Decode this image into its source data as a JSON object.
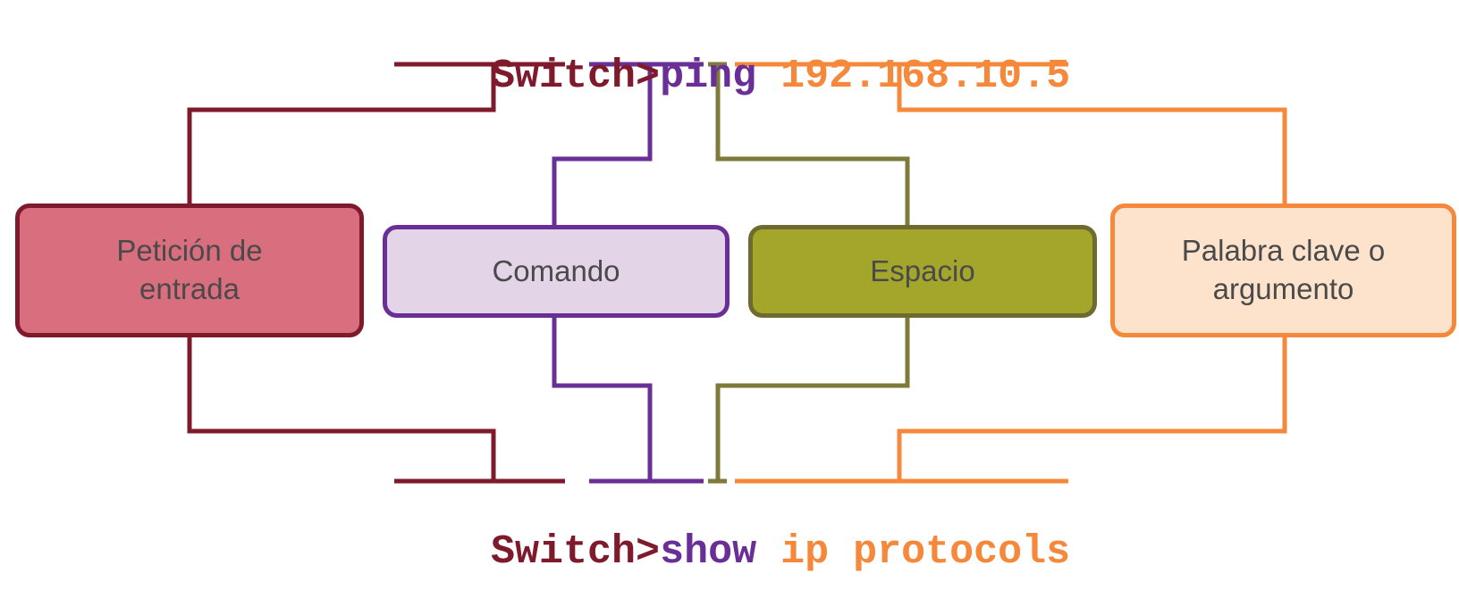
{
  "colors": {
    "prompt": "#7f1a2d",
    "command": "#6a2f97",
    "space": "#7d7a3a",
    "argument": "#f5883a"
  },
  "top_line": {
    "prompt": "Switch>",
    "command": "ping",
    "argument": "192.168.10.5"
  },
  "bottom_line": {
    "prompt": "Switch>",
    "command": "show",
    "argument": "ip protocols"
  },
  "boxes": {
    "prompt": {
      "line1": "Petición de",
      "line2": "entrada"
    },
    "command": {
      "line1": "Comando"
    },
    "space": {
      "line1": "Espacio"
    },
    "argument": {
      "line1": "Palabra clave o",
      "line2": "argumento"
    }
  }
}
